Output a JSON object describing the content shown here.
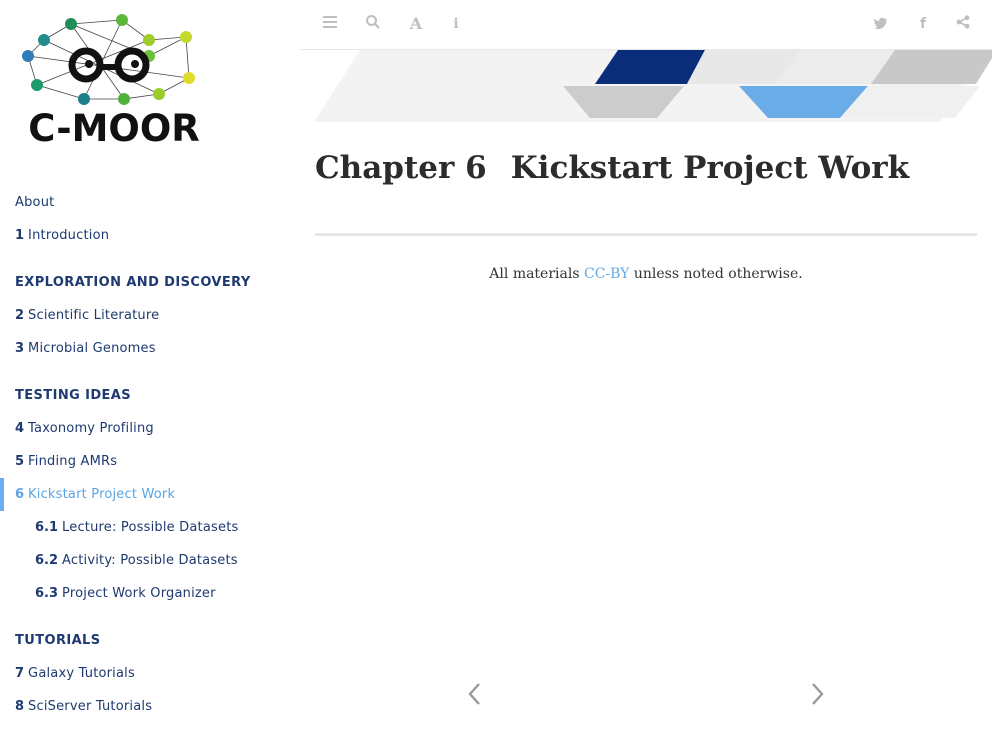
{
  "logo": {
    "wordmark": "C-MOOR"
  },
  "toc": {
    "about": "About",
    "ch1": {
      "num": "1",
      "label": "Introduction"
    },
    "part1": "EXPLORATION AND DISCOVERY",
    "ch2": {
      "num": "2",
      "label": "Scientific Literature"
    },
    "ch3": {
      "num": "3",
      "label": "Microbial Genomes"
    },
    "part2": "TESTING IDEAS",
    "ch4": {
      "num": "4",
      "label": "Taxonomy Profiling"
    },
    "ch5": {
      "num": "5",
      "label": "Finding AMRs"
    },
    "ch6": {
      "num": "6",
      "label": "Kickstart Project Work"
    },
    "s61": {
      "num": "6.1",
      "label": "Lecture: Possible Datasets"
    },
    "s62": {
      "num": "6.2",
      "label": "Activity: Possible Datasets"
    },
    "s63": {
      "num": "6.3",
      "label": "Project Work Organizer"
    },
    "part3": "TUTORIALS",
    "ch7": {
      "num": "7",
      "label": "Galaxy Tutorials"
    },
    "ch8": {
      "num": "8",
      "label": "SciServer Tutorials"
    }
  },
  "toolbar": {
    "icons": [
      "toc-toggle-icon",
      "search-icon",
      "font-settings-icon",
      "info-icon",
      "twitter-icon",
      "facebook-icon",
      "share-icon"
    ]
  },
  "main": {
    "chapter_number": "Chapter 6",
    "chapter_title": "Kickstart Project Work",
    "footer_prefix": "All materials ",
    "footer_link": "CC-BY",
    "footer_suffix": " unless noted otherwise."
  },
  "colors": {
    "accent": "#5aa4e4",
    "nav_text": "#1e3a70",
    "banner_dark": "#0a2d7a",
    "banner_light": "#69ace8"
  }
}
